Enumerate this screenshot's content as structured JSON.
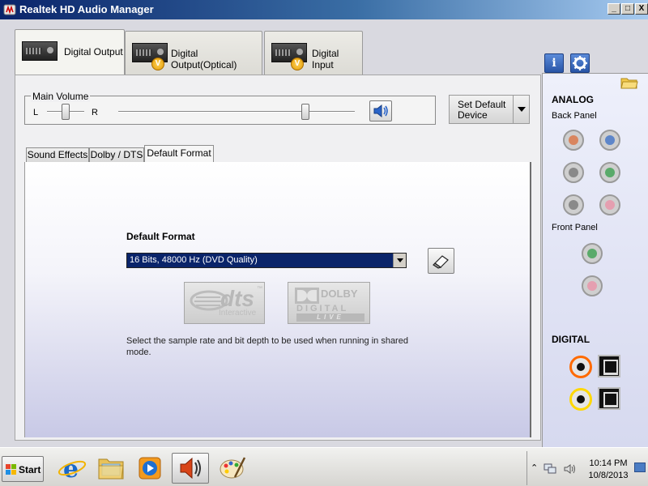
{
  "window": {
    "title": "Realtek HD Audio Manager",
    "controls": {
      "minimize": "_",
      "maximize": "□",
      "close": "X"
    }
  },
  "device_tabs": [
    {
      "label": "Digital Output",
      "active": true
    },
    {
      "label": "Digital Output(Optical)",
      "active": false
    },
    {
      "label": "Digital Input",
      "active": false
    }
  ],
  "volume": {
    "title": "Main Volume",
    "left_label": "L",
    "right_label": "R",
    "balance_level": 0.5,
    "volume_level": 0.79
  },
  "set_default": {
    "label": "Set Default Device"
  },
  "sub_tabs": [
    {
      "label": "Sound Effects",
      "active": false
    },
    {
      "label": "Dolby / DTS",
      "active": false
    },
    {
      "label": "Default Format",
      "active": true
    }
  ],
  "default_format": {
    "title": "Default Format",
    "selected": "16 Bits, 48000 Hz (DVD Quality)",
    "description": "Select the sample rate and bit depth to be used when running in shared mode."
  },
  "logos": {
    "dts": {
      "word": "dts",
      "sub": "Interactive",
      "tm": "™"
    },
    "dolby": {
      "word": "DOLBY",
      "line2": "DIGITAL",
      "line3": "LIVE"
    }
  },
  "right_panel": {
    "analog_heading": "ANALOG",
    "back_panel_label": "Back Panel",
    "front_panel_label": "Front Panel",
    "digital_heading": "DIGITAL",
    "info_icon": "i",
    "jack_colors": {
      "orange": "#d9865f",
      "blue": "#5e86c9",
      "gray": "#8a8a8a",
      "green": "#5aaa6a",
      "pink": "#e59fb0",
      "black": "#555555"
    },
    "coax_colors": {
      "orange": "#ff6a00",
      "yellow": "#ffd800"
    }
  },
  "taskbar": {
    "start_label": "Start",
    "clock_time": "10:14 PM",
    "clock_date": "10/8/2013"
  }
}
